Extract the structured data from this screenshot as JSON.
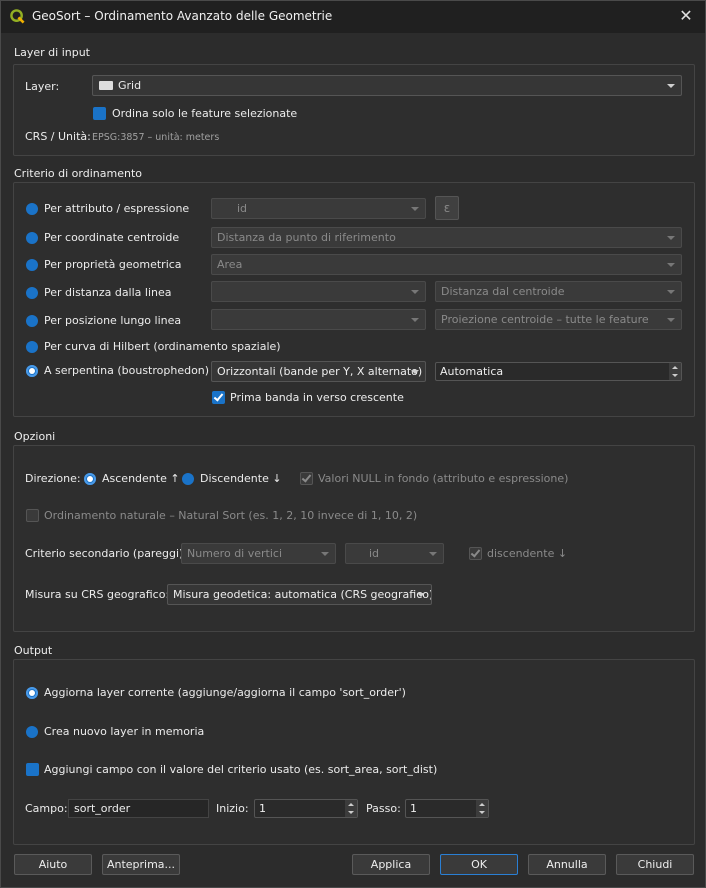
{
  "window": {
    "title": "GeoSort – Ordinamento Avanzato delle Geometrie"
  },
  "input": {
    "section_title": "Layer di input",
    "layer_label": "Layer:",
    "layer_value": "Grid",
    "selected_only_label": "Ordina solo le feature selezionate",
    "crs_label": "CRS / Unità:",
    "crs_value": "EPSG:3857 – unità: meters"
  },
  "criteria": {
    "section_title": "Criterio di ordinamento",
    "attr_label": "Per attributo / espressione",
    "attr_value": "id",
    "centroid_label": "Per coordinate centroide",
    "centroid_value": "Distanza da punto di riferimento",
    "geomprop_label": "Per proprietà geometrica",
    "geomprop_value": "Area",
    "linedist_label": "Per distanza dalla linea",
    "linedist_value": "",
    "linedist_mode": "Distanza dal centroide",
    "linepos_label": "Per posizione lungo linea",
    "linepos_value": "",
    "linepos_mode": "Proiezione centroide  –  tutte le feature",
    "hilbert_label": "Per curva di Hilbert (ordinamento spaziale)",
    "serp_label": "A serpentina (boustrophedon)",
    "serp_value": "Orizzontali (bande per Y, X alternato)",
    "serp_size": "Automatica",
    "first_band_label": "Prima banda in verso crescente"
  },
  "options": {
    "section_title": "Opzioni",
    "direction_label": "Direzione:",
    "asc_label": "Ascendente ↑",
    "desc_label": "Discendente ↓",
    "nulls_label": "Valori NULL in fondo (attributo e espressione)",
    "natural_label": "Ordinamento naturale – Natural Sort (es. 1, 2, 10 invece di 1, 10, 2)",
    "secondary_label": "Criterio secondario (pareggi):",
    "secondary_value": "Numero di vertici",
    "secondary_field": "id",
    "secondary_desc_label": "discendente ↓",
    "geo_label": "Misura su CRS geografico:",
    "geo_value": "Misura geodetica: automatica (CRS geografico)"
  },
  "output": {
    "section_title": "Output",
    "update_label": "Aggiorna layer corrente (aggiunge/aggiorna il campo 'sort_order')",
    "new_label": "Crea nuovo layer in memoria",
    "addfield_label": "Aggiungi campo con il valore del criterio usato (es. sort_area, sort_dist)",
    "field_label": "Campo:",
    "field_value": "sort_order",
    "start_label": "Inizio:",
    "start_value": "1",
    "step_label": "Passo:",
    "step_value": "1"
  },
  "buttons": {
    "help": "Aiuto",
    "preview": "Anteprima...",
    "apply": "Applica",
    "ok": "OK",
    "cancel": "Annulla",
    "close": "Chiudi"
  }
}
